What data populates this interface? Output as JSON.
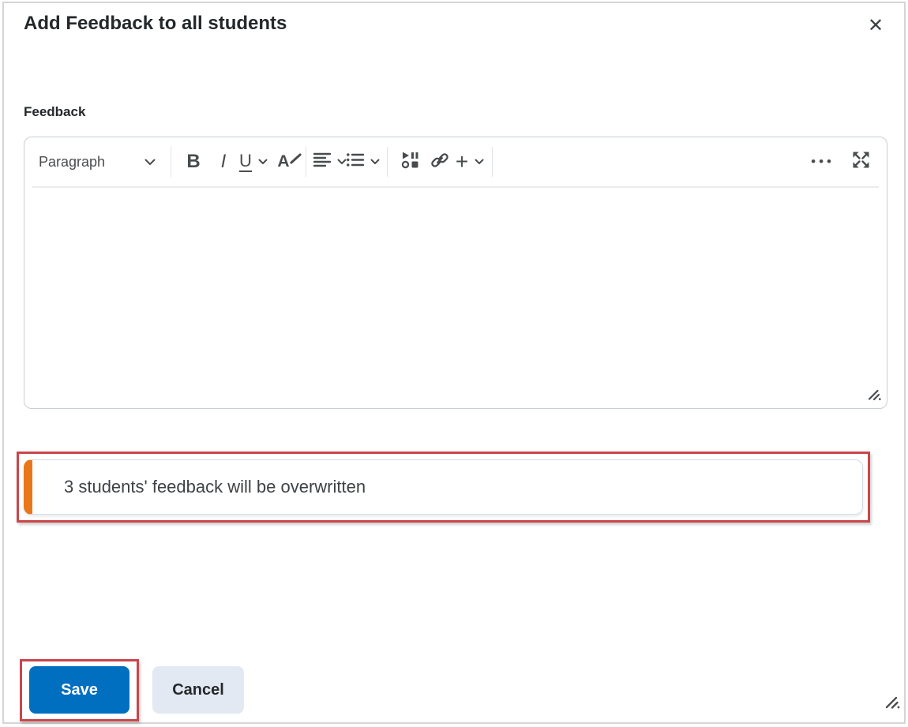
{
  "colors": {
    "primary_blue": "#006fbf",
    "warning_orange": "#e8761b",
    "annotation_red": "#c9464b",
    "toolbar_icon_gray": "#494c4e"
  },
  "dialog": {
    "title": "Add Feedback to all students",
    "close_glyph": "✕"
  },
  "form": {
    "feedback_label": "Feedback"
  },
  "editor": {
    "paragraph_label": "Paragraph",
    "bold_glyph": "B",
    "italic_glyph": "I",
    "underline_glyph": "U",
    "font_color_glyph": "A",
    "plus_glyph": "+",
    "more_glyph": "•••"
  },
  "warning": {
    "message": "3 students' feedback will be overwritten"
  },
  "actions": {
    "save_label": "Save",
    "cancel_label": "Cancel"
  }
}
